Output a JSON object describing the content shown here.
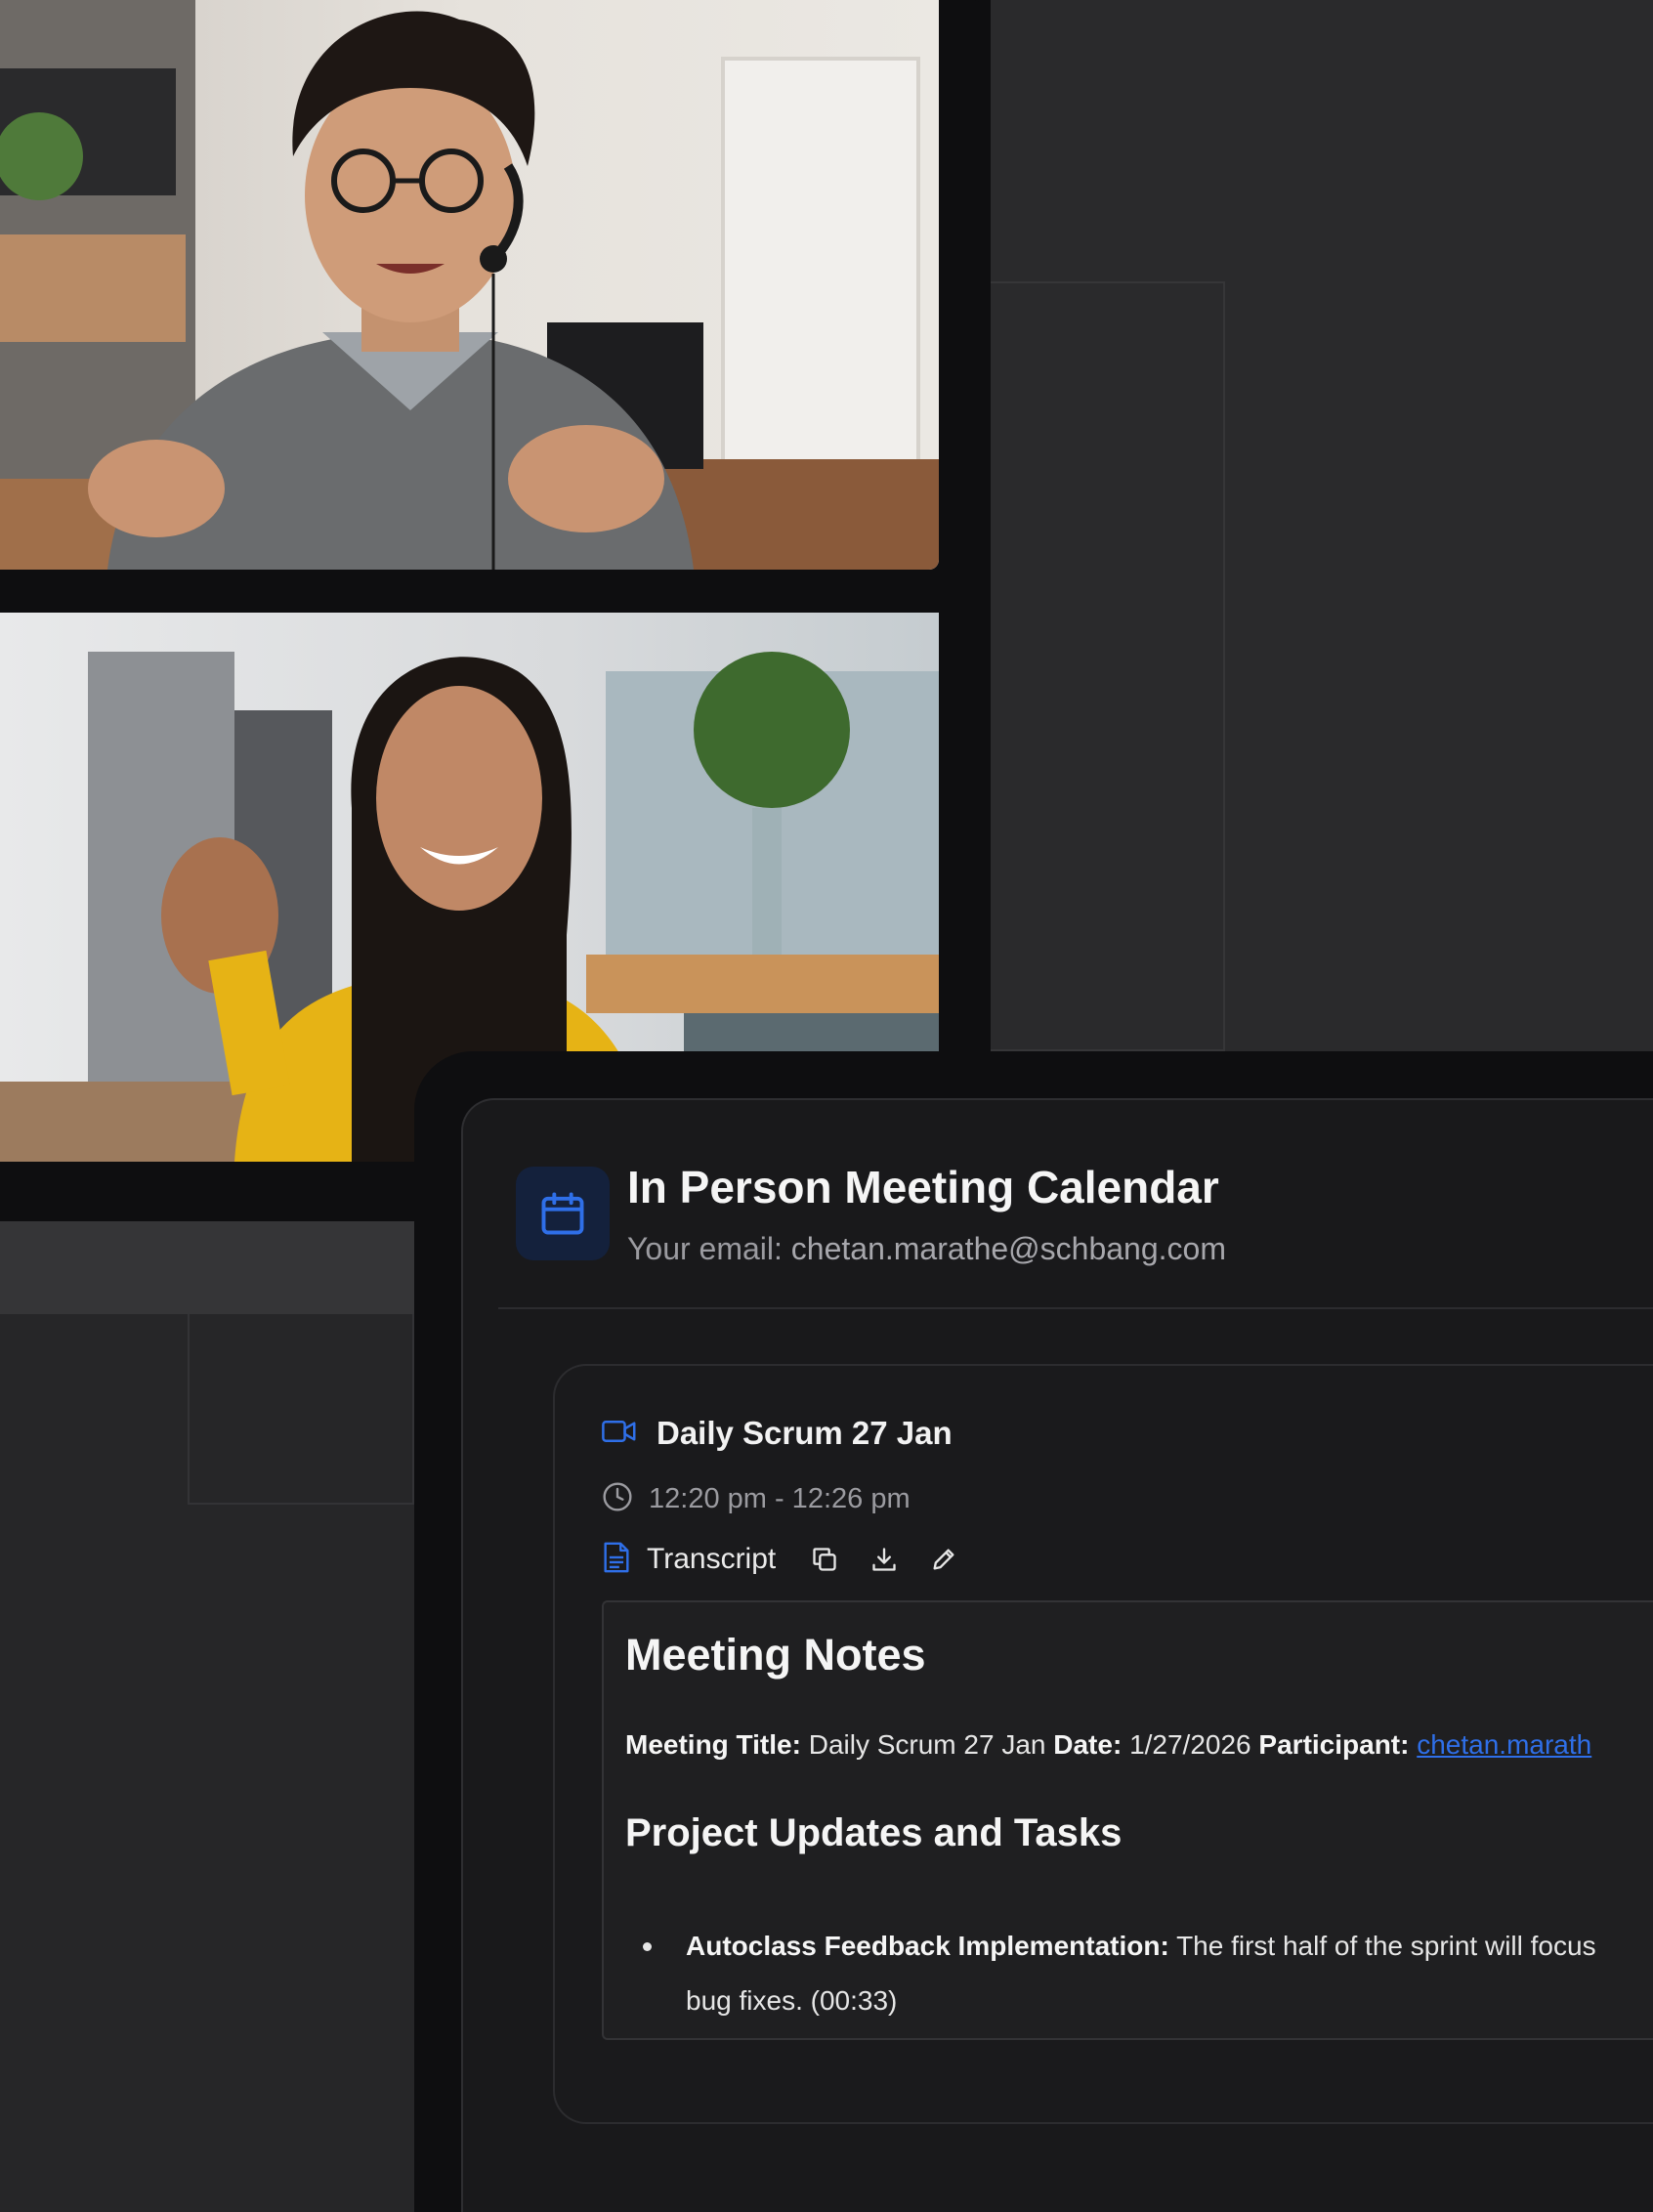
{
  "calendar": {
    "title": "In Person Meeting Calendar",
    "email_label": "Your email:",
    "email_value": "chetan.marathe@schbang.com",
    "icon": "calendar-icon"
  },
  "meeting": {
    "title": "Daily Scrum 27 Jan",
    "time": "12:20 pm - 12:26 pm",
    "transcript_label": "Transcript",
    "icons": [
      "video-icon",
      "clock-icon",
      "document-icon",
      "copy-icon",
      "download-icon",
      "edit-icon"
    ]
  },
  "notes": {
    "heading": "Meeting Notes",
    "meta": {
      "title_label": "Meeting Title:",
      "title_value": "Daily Scrum 27 Jan",
      "date_label": "Date:",
      "date_value": "1/27/2026",
      "participant_label": "Participant:",
      "participant_value": "chetan.marath"
    },
    "section_heading": "Project Updates and Tasks",
    "bullets": [
      {
        "label": "Autoclass Feedback Implementation:",
        "text_line1": "The first half of the sprint will focus",
        "text_line2": "bug fixes. (00:33)"
      }
    ]
  },
  "colors": {
    "accent": "#2f6fe8",
    "panel_bg": "#19191b",
    "page_bg": "#2a2a2c"
  }
}
